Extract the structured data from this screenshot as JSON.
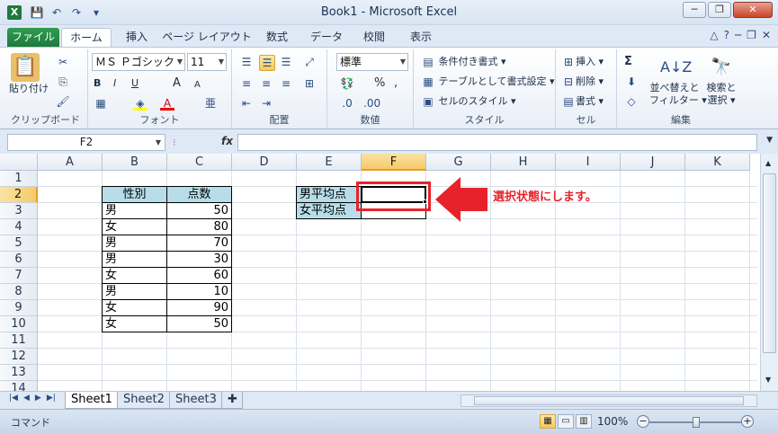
{
  "window": {
    "title": "Book1 - Microsoft Excel",
    "app_icon": "X",
    "minimize": "─",
    "restore": "❐",
    "close": "✕"
  },
  "qat": {
    "save": "💾",
    "undo": "↶",
    "redo": "↷",
    "customize": "▾"
  },
  "tabs": [
    {
      "label": "ファイル"
    },
    {
      "label": "ホーム"
    },
    {
      "label": "挿入"
    },
    {
      "label": "ページ レイアウト"
    },
    {
      "label": "数式"
    },
    {
      "label": "データ"
    },
    {
      "label": "校閲"
    },
    {
      "label": "表示"
    }
  ],
  "ribbon": {
    "clipboard": {
      "label": "クリップボード",
      "paste": "貼り付け"
    },
    "font": {
      "label": "フォント",
      "name": "ＭＳ Ｐゴシック",
      "size": "11",
      "bold": "B",
      "italic": "I",
      "underline": "U",
      "grow": "A",
      "shrink": "A"
    },
    "alignment": {
      "label": "配置"
    },
    "number": {
      "label": "数値",
      "format": "標準",
      "currency": "%",
      "comma": ","
    },
    "styles": {
      "label": "スタイル",
      "conditional": "条件付き書式",
      "table": "テーブルとして書式設定",
      "cell": "セルのスタイル"
    },
    "cells": {
      "label": "セル",
      "insert": "挿入",
      "delete": "削除",
      "format": "書式"
    },
    "editing": {
      "label": "編集",
      "sort": "並べ替えと",
      "filter": "フィルター",
      "find": "検索と",
      "select": "選択",
      "sigma": "Σ"
    }
  },
  "formula_bar": {
    "name_box": "F2",
    "fx": "fx",
    "value": ""
  },
  "grid": {
    "columns": [
      "A",
      "B",
      "C",
      "D",
      "E",
      "F",
      "G",
      "H",
      "I",
      "J",
      "K"
    ],
    "rows": [
      "1",
      "2",
      "3",
      "4",
      "5",
      "6",
      "7",
      "8",
      "9",
      "10",
      "11",
      "12",
      "13",
      "14"
    ],
    "table_headers": [
      "性別",
      "点数"
    ],
    "table_rows": [
      {
        "gender": "男",
        "score": "50"
      },
      {
        "gender": "女",
        "score": "80"
      },
      {
        "gender": "男",
        "score": "70"
      },
      {
        "gender": "男",
        "score": "30"
      },
      {
        "gender": "女",
        "score": "60"
      },
      {
        "gender": "男",
        "score": "10"
      },
      {
        "gender": "女",
        "score": "90"
      },
      {
        "gender": "女",
        "score": "50"
      }
    ],
    "labels": [
      "男平均点",
      "女平均点"
    ],
    "active_cell": "F2",
    "annotation": "選択状態にします。",
    "annotation_color": "#e8222a"
  },
  "sheets": [
    {
      "label": "Sheet1"
    },
    {
      "label": "Sheet2"
    },
    {
      "label": "Sheet3"
    }
  ],
  "status": {
    "mode": "コマンド",
    "zoom": "100%",
    "zoom_minus": "−",
    "zoom_plus": "+"
  }
}
